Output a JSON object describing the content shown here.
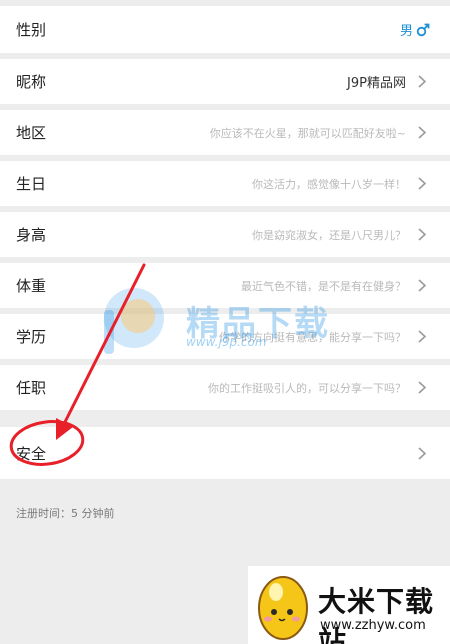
{
  "profile": {
    "rows": [
      {
        "label": "性别",
        "value": "男",
        "icon": "male-symbol-icon"
      },
      {
        "label": "昵称",
        "value": "J9P精品网"
      },
      {
        "label": "地区",
        "value": "你应该不在火星，那就可以匹配好友啦~"
      },
      {
        "label": "生日",
        "value": "你这活力，感觉像十八岁一样！"
      },
      {
        "label": "身高",
        "value": "你是窈窕淑女，还是八尺男儿？"
      },
      {
        "label": "体重",
        "value": "最近气色不错，是不是有在健身？"
      },
      {
        "label": "学历",
        "value": "你学的方向挺有意思，能分享一下吗？"
      },
      {
        "label": "任职",
        "value": "你的工作挺吸引人的，可以分享一下吗？"
      }
    ],
    "safety_label": "安全",
    "registered": "注册时间：5 分钟前"
  },
  "watermark": {
    "text": "精品下载",
    "url": "www.j9p.com"
  },
  "brand": {
    "name": "大米下载站",
    "url": "www.zzhyw.com"
  },
  "colors": {
    "accent": "#1e90d6",
    "annotation": "#e8202a",
    "background": "#ededed"
  }
}
